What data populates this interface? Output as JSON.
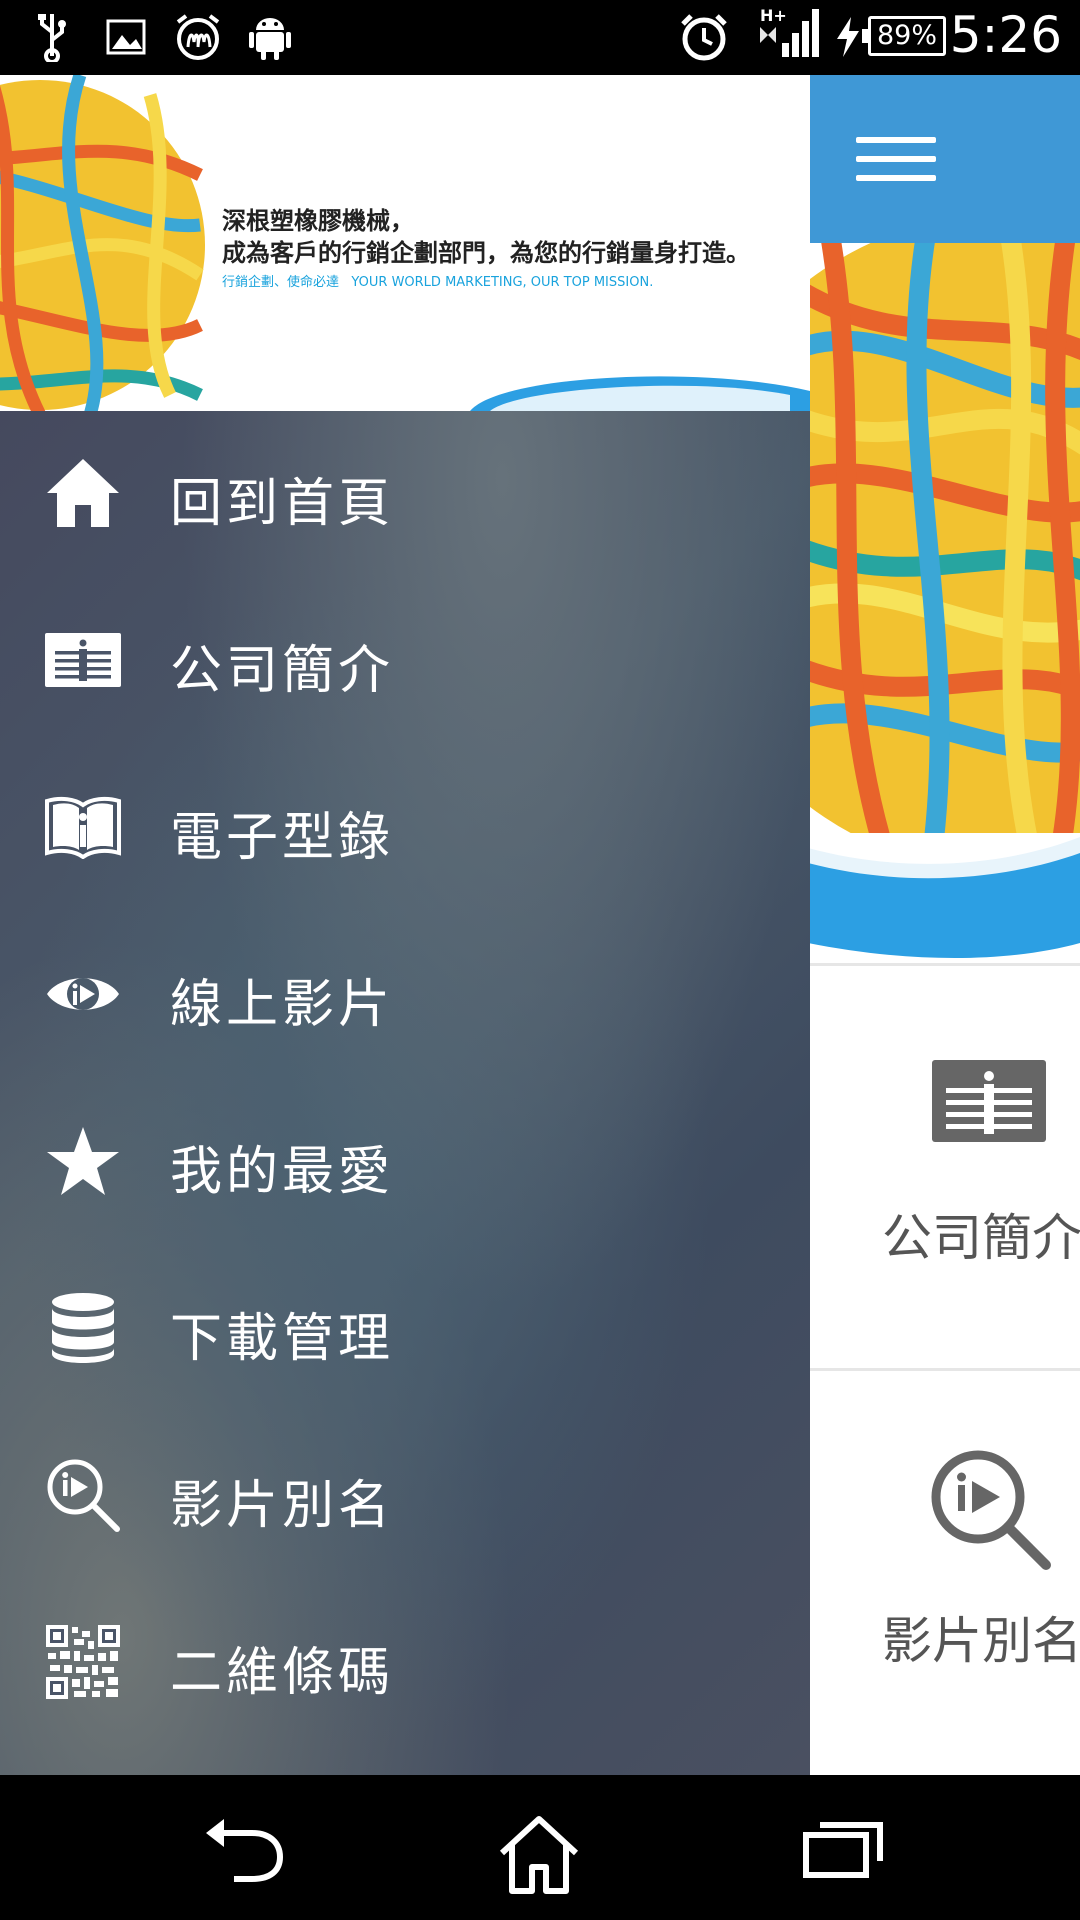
{
  "status_bar": {
    "battery": "89%",
    "time": "5:26",
    "network": "H+",
    "icons": [
      "usb-icon",
      "image-icon",
      "mcdonalds-alarm-icon",
      "android-icon",
      "alarm-clock-icon",
      "signal-icon",
      "charging-icon",
      "battery-icon"
    ]
  },
  "banner": {
    "line1": "深根塑橡膠機械，",
    "line2": "成為客戶的行銷企劃部門，為您的行銷量身打造。",
    "tagline_cn": "行銷企劃、使命必達",
    "tagline_en": "YOUR WORLD MARKETING, OUR TOP MISSION."
  },
  "drawer": {
    "items": [
      {
        "label": "回到首頁",
        "icon": "home-icon"
      },
      {
        "label": "公司簡介",
        "icon": "company-info-icon"
      },
      {
        "label": "電子型錄",
        "icon": "catalog-book-icon"
      },
      {
        "label": "線上影片",
        "icon": "video-eye-icon"
      },
      {
        "label": "我的最愛",
        "icon": "star-icon"
      },
      {
        "label": "下載管理",
        "icon": "database-icon"
      },
      {
        "label": "影片別名",
        "icon": "video-search-icon"
      },
      {
        "label": "二維條碼",
        "icon": "qr-code-icon"
      }
    ]
  },
  "content": {
    "tiles": [
      {
        "label": "公司簡介",
        "icon": "company-info-icon"
      },
      {
        "label": "影片別名",
        "icon": "video-search-icon"
      }
    ],
    "colors": {
      "appbar": "#3f98d6",
      "tile_text": "#555555"
    }
  },
  "nav_bar": {
    "buttons": [
      "back-icon",
      "home-nav-icon",
      "recents-icon"
    ]
  }
}
